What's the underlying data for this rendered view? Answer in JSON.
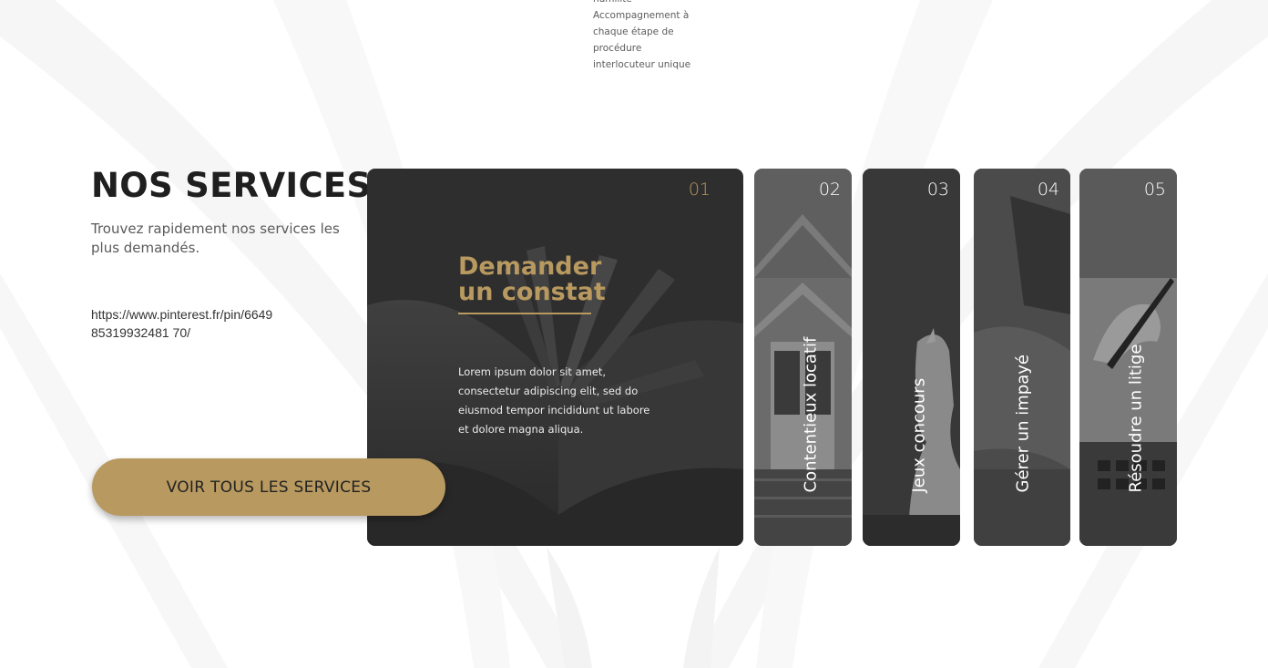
{
  "top_list": {
    "item1": "humilité",
    "item2": "Accompagnement à",
    "item3": "chaque étape de",
    "item4": "procédure",
    "item5": " interlocuteur unique"
  },
  "services": {
    "title": "NOS SERVICES",
    "subtitle": "Trouvez rapidement nos services les plus demandés.",
    "link": "https://www.pinterest.fr/pin/664985319932481 70/",
    "cta_label": "VOIR TOUS LES SERVICES"
  },
  "cards": [
    {
      "num": "01",
      "heading_line1": "Demander",
      "heading_line2": "un constat",
      "text": "Lorem ipsum dolor sit amet, consectetur adipiscing elit, sed do eiusmod tempor incididunt ut labore et dolore magna aliqua."
    },
    {
      "num": "02",
      "label": "Contentieux locatif"
    },
    {
      "num": "03",
      "label": "Jeux concours"
    },
    {
      "num": "04",
      "label": "Gérer un impayé"
    },
    {
      "num": "05",
      "label": "Résoudre un litige"
    }
  ],
  "colors": {
    "accent": "#b8995f",
    "card_dark": "#2f2f2f",
    "heading": "#1f1f1f"
  },
  "icons": [
    "book-image",
    "house-image",
    "chess-knight-image",
    "laptop-image",
    "writing-hand-image"
  ]
}
